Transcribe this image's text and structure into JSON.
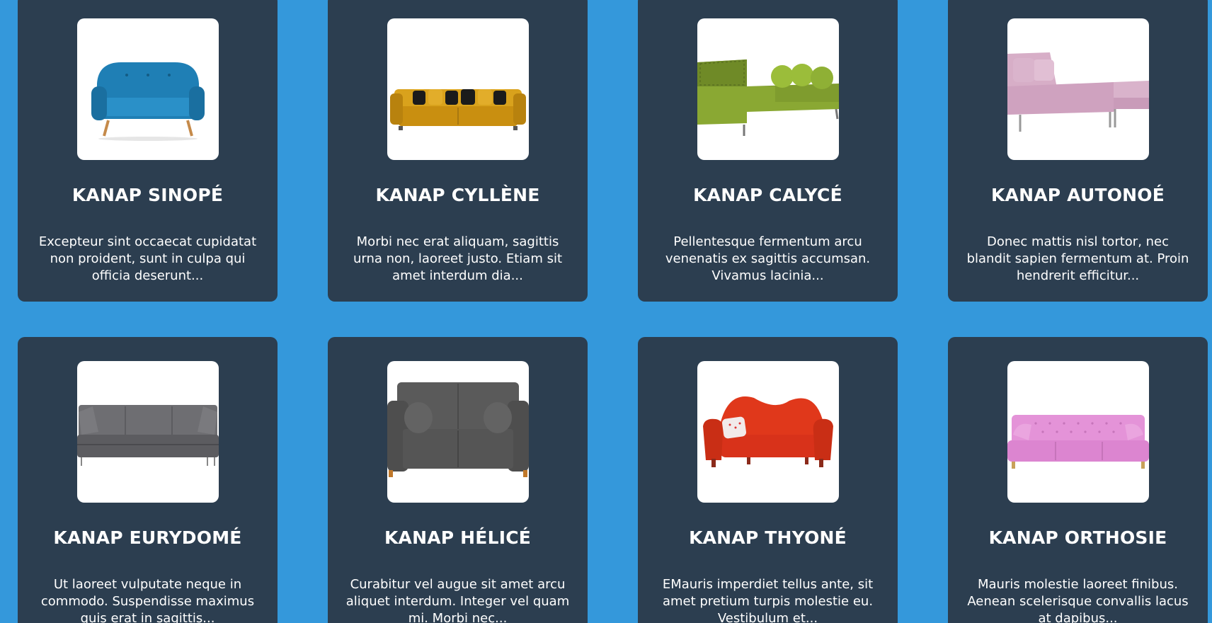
{
  "colors": {
    "page_background": "#3498db",
    "card_background": "#2c3e50",
    "text": "#ffffff"
  },
  "products": [
    {
      "name": "KANAP SINOPÉ",
      "description": "Excepteur sint occaecat cupidatat non proident, sunt in culpa qui officia deserunt...",
      "image_icon": "blue-sofa-icon",
      "sofa_color": "#1f7fb5"
    },
    {
      "name": "KANAP CYLLÈNE",
      "description": "Morbi nec erat aliquam, sagittis urna non, laoreet justo. Etiam sit amet interdum dia...",
      "image_icon": "yellow-sofa-icon",
      "sofa_color": "#d9a21c"
    },
    {
      "name": "KANAP CALYCÉ",
      "description": "Pellentesque fermentum arcu venenatis ex sagittis accumsan. Vivamus lacinia...",
      "image_icon": "green-sectional-sofa-icon",
      "sofa_color": "#8aa833"
    },
    {
      "name": "KANAP AUTONOÉ",
      "description": "Donec mattis nisl tortor, nec blandit sapien fermentum at. Proin hendrerit efficitur...",
      "image_icon": "pink-chaise-sofa-icon",
      "sofa_color": "#d7aec7"
    },
    {
      "name": "KANAP EURYDOMÉ",
      "description": "Ut laoreet vulputate neque in commodo. Suspendisse maximus quis erat in sagittis...",
      "image_icon": "grey-sofa-icon",
      "sofa_color": "#6e6e72"
    },
    {
      "name": "KANAP HÉLICÉ",
      "description": "Curabitur vel augue sit amet arcu aliquet interdum. Integer vel quam mi. Morbi nec...",
      "image_icon": "dark-grey-loveseat-icon",
      "sofa_color": "#555555"
    },
    {
      "name": "KANAP THYONÉ",
      "description": "EMauris imperdiet tellus ante, sit amet pretium turpis molestie eu. Vestibulum et...",
      "image_icon": "red-sofa-icon",
      "sofa_color": "#e0381b"
    },
    {
      "name": "KANAP ORTHOSIE",
      "description": "Mauris molestie laoreet finibus. Aenean scelerisque convallis lacus at dapibus...",
      "image_icon": "pink-chesterfield-sofa-icon",
      "sofa_color": "#e493d8"
    }
  ]
}
